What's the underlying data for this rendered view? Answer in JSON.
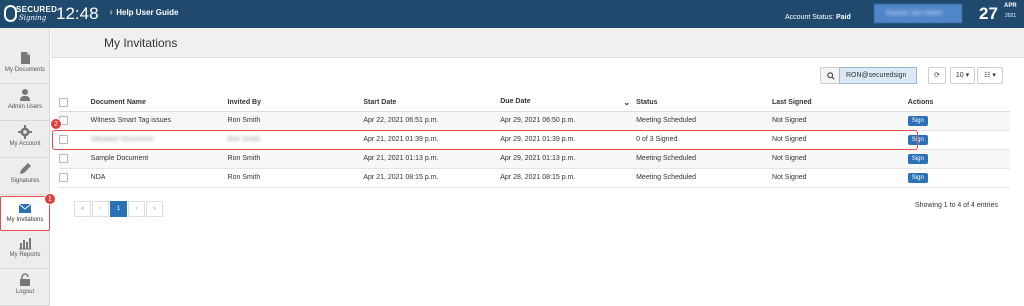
{
  "header": {
    "logo_text": "SECURED",
    "logo_sub": "Signing",
    "time": "12:48",
    "help_label": "Help User Guide",
    "account_status_label": "Account Status:",
    "account_status_value": "Paid",
    "user_name": "Maxine Van Halen",
    "date_day": "27",
    "date_month": "APR",
    "date_year": "2021"
  },
  "sidebar": {
    "items": [
      {
        "label": "My Documents",
        "icon": "document-icon"
      },
      {
        "label": "Admin Users",
        "icon": "user-icon"
      },
      {
        "label": "My Account",
        "icon": "gear-icon"
      },
      {
        "label": "Signatures",
        "icon": "pencil-icon"
      },
      {
        "label": "My Invitations",
        "icon": "envelope-icon"
      },
      {
        "label": "My Reports",
        "icon": "bar-chart-icon"
      },
      {
        "label": "Logout",
        "icon": "lock-icon"
      }
    ],
    "active_badge": "1"
  },
  "page": {
    "title": "My Invitations",
    "search_value": "RON@securedsign",
    "page_size": "10",
    "row_badge": "2"
  },
  "table": {
    "columns": [
      "Document Name",
      "Invited By",
      "Start Date",
      "Due Date",
      "Status",
      "Last Signed",
      "Actions"
    ],
    "rows": [
      {
        "doc": "Witness Smart Tag issues",
        "by": "Ron Smith",
        "start": "Apr 22, 2021 06:51 p.m.",
        "due": "Apr 29, 2021 06:50 p.m.",
        "status": "Meeting Scheduled",
        "last": "Not Signed",
        "action": "Sign"
      },
      {
        "doc": "Valuation Document",
        "by": "Ron Smith",
        "start": "Apr 21, 2021 01:39 p.m.",
        "due": "Apr 29, 2021 01:39 p.m.",
        "status": "0 of 3 Signed",
        "last": "Not Signed",
        "action": "Sign"
      },
      {
        "doc": "Sample Document",
        "by": "Ron Smith",
        "start": "Apr 21, 2021 01:13 p.m.",
        "due": "Apr 29, 2021 01:13 p.m.",
        "status": "Meeting Scheduled",
        "last": "Not Signed",
        "action": "Sign"
      },
      {
        "doc": "NDA",
        "by": "Ron Smith",
        "start": "Apr 21, 2021 08:15 p.m.",
        "due": "Apr 28, 2021 08:15 p.m.",
        "status": "Meeting Scheduled",
        "last": "Not Signed",
        "action": "Sign"
      }
    ]
  },
  "pagination": {
    "first": "«",
    "prev": "‹",
    "current": "1",
    "next": "›",
    "last": "»",
    "summary": "Showing 1 to 4 of 4 entries"
  },
  "colors": {
    "topbar": "#1f4a6e",
    "primary": "#2a72b5",
    "highlight": "#e74c4c"
  }
}
